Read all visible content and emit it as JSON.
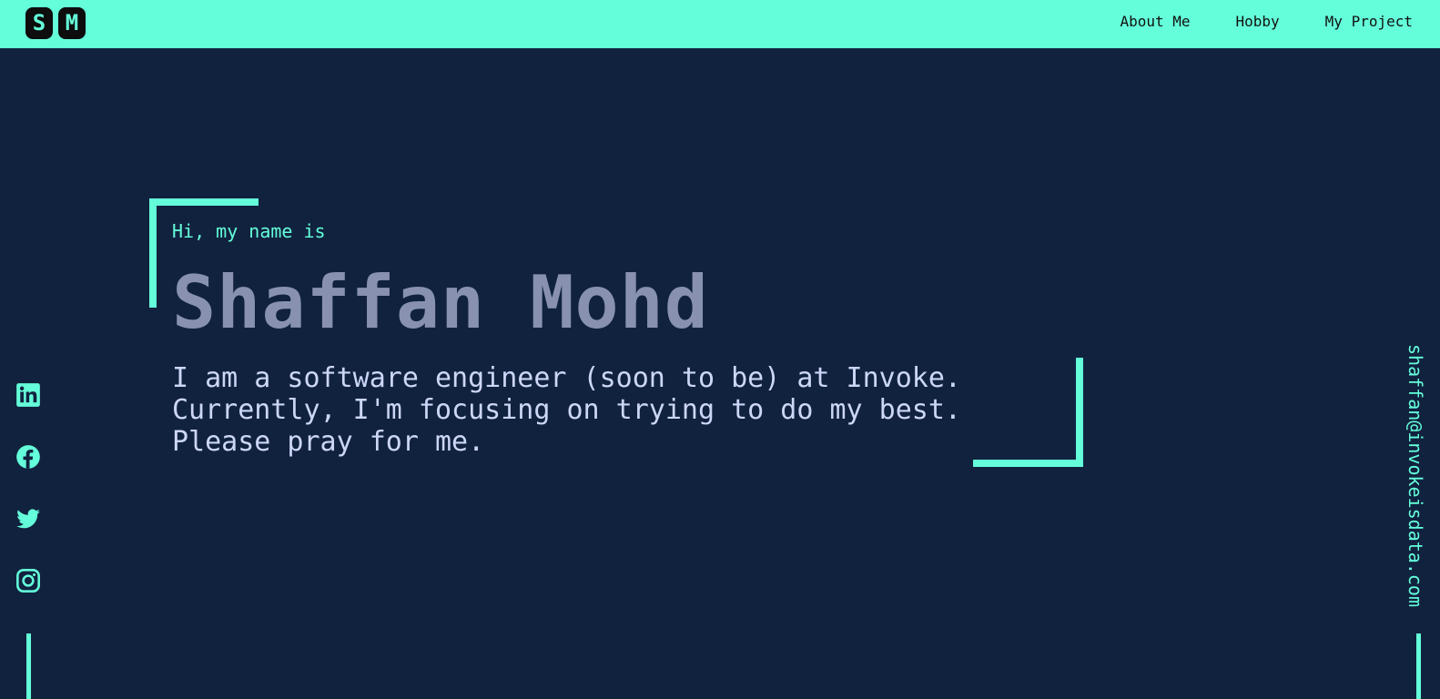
{
  "header": {
    "logo_letters": [
      "S",
      "M"
    ],
    "nav": [
      {
        "label": "About Me"
      },
      {
        "label": "Hobby"
      },
      {
        "label": "My Project"
      }
    ]
  },
  "hero": {
    "greeting": "Hi, my name is",
    "name": "Shaffan Mohd",
    "bio_lines": [
      "I am a software engineer (soon to be) at Invoke.",
      "Currently, I'm focusing on trying to do my best.",
      "Please pray for me."
    ]
  },
  "social": {
    "icons": [
      "linkedin-icon",
      "facebook-icon",
      "twitter-icon",
      "instagram-icon"
    ]
  },
  "contact": {
    "email": "shaffan@invokeisdata.com"
  },
  "colors": {
    "accent": "#64ffda",
    "background": "#11223f",
    "name_text": "#8892b0",
    "bio_text": "#ccd6f6"
  }
}
